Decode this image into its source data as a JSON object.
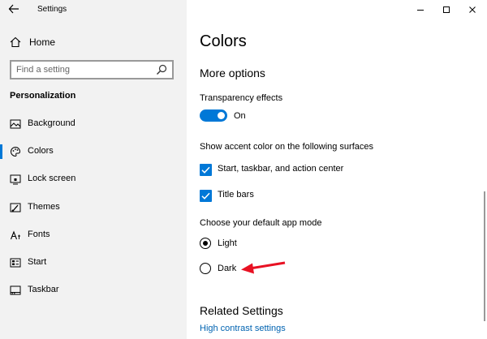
{
  "window": {
    "title": "Settings",
    "controls": [
      "minimize-icon",
      "maximize-icon",
      "close-icon"
    ]
  },
  "sidebar": {
    "home_label": "Home",
    "search_placeholder": "Find a setting",
    "section_label": "Personalization",
    "items": [
      {
        "label": "Background",
        "icon": "picture-icon",
        "active": false
      },
      {
        "label": "Colors",
        "icon": "palette-icon",
        "active": true
      },
      {
        "label": "Lock screen",
        "icon": "lock-screen-icon",
        "active": false
      },
      {
        "label": "Themes",
        "icon": "themes-icon",
        "active": false
      },
      {
        "label": "Fonts",
        "icon": "fonts-icon",
        "active": false
      },
      {
        "label": "Start",
        "icon": "start-icon",
        "active": false
      },
      {
        "label": "Taskbar",
        "icon": "taskbar-icon",
        "active": false
      }
    ]
  },
  "main": {
    "title": "Colors",
    "more_options_heading": "More options",
    "transparency": {
      "label": "Transparency effects",
      "state": "On",
      "value": true
    },
    "accent_surfaces_label": "Show accent color on the following surfaces",
    "checkboxes": [
      {
        "label": "Start, taskbar, and action center",
        "checked": true
      },
      {
        "label": "Title bars",
        "checked": true
      }
    ],
    "app_mode_label": "Choose your default app mode",
    "app_mode_options": [
      {
        "label": "Light",
        "selected": true
      },
      {
        "label": "Dark",
        "selected": false
      }
    ],
    "related_heading": "Related Settings",
    "related_link": "High contrast settings"
  },
  "colors": {
    "accent": "#0078d7",
    "arrow": "#e81123",
    "sidebar_bg": "#f2f2f2"
  }
}
